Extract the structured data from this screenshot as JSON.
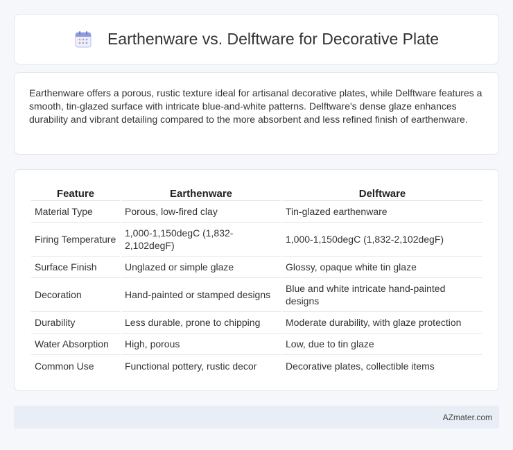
{
  "header": {
    "icon": "calendar-icon",
    "title": "Earthenware vs. Delftware for Decorative Plate"
  },
  "summary": {
    "text": "Earthenware offers a porous, rustic texture ideal for artisanal decorative plates, while Delftware features a smooth, tin-glazed surface with intricate blue-and-white patterns. Delftware's dense glaze enhances durability and vibrant detailing compared to the more absorbent and less refined finish of earthenware."
  },
  "table": {
    "headers": [
      "Feature",
      "Earthenware",
      "Delftware"
    ],
    "rows": [
      [
        "Material Type",
        "Porous, low-fired clay",
        "Tin-glazed earthenware"
      ],
      [
        "Firing Temperature",
        "1,000-1,150degC (1,832-2,102degF)",
        "1,000-1,150degC (1,832-2,102degF)"
      ],
      [
        "Surface Finish",
        "Unglazed or simple glaze",
        "Glossy, opaque white tin glaze"
      ],
      [
        "Decoration",
        "Hand-painted or stamped designs",
        "Blue and white intricate hand-painted designs"
      ],
      [
        "Durability",
        "Less durable, prone to chipping",
        "Moderate durability, with glaze protection"
      ],
      [
        "Water Absorption",
        "High, porous",
        "Low, due to tin glaze"
      ],
      [
        "Common Use",
        "Functional pottery, rustic decor",
        "Decorative plates, collectible items"
      ]
    ]
  },
  "footer": {
    "text": "AZmater.com"
  }
}
